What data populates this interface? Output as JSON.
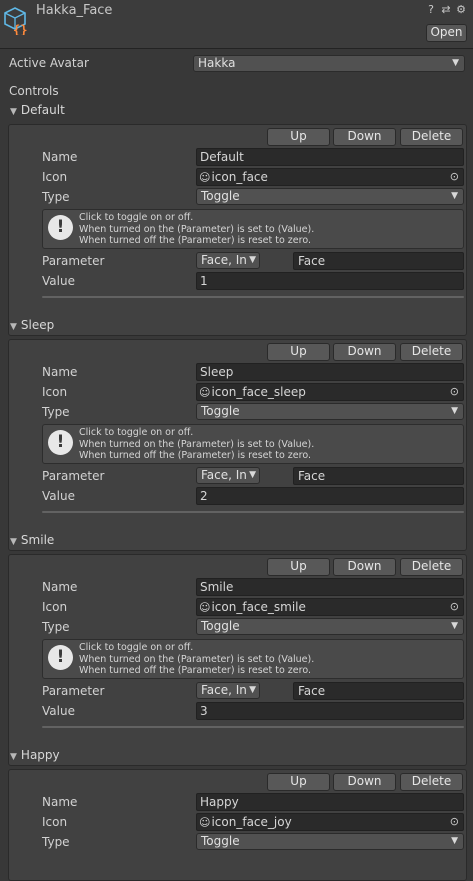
{
  "header": {
    "title": "Hakka_Face",
    "open_label": "Open",
    "help_icon": "?",
    "settings_icon": "⇄",
    "gear_icon": "⚙"
  },
  "active_avatar": {
    "label": "Active Avatar",
    "value": "Hakka"
  },
  "controls_label": "Controls",
  "controls": [
    {
      "title": "Default",
      "buttons": {
        "up": "Up",
        "down": "Down",
        "delete": "Delete"
      },
      "name_label": "Name",
      "name": "Default",
      "icon_label": "Icon",
      "icon": "icon_face",
      "type_label": "Type",
      "type": "Toggle",
      "help": [
        "Click to toggle on or off.",
        "When turned on the (Parameter) is set to (Value).",
        "When turned off the (Parameter) is reset to zero."
      ],
      "parameter_label": "Parameter",
      "parameter_type": "Face, In",
      "parameter": "Face",
      "value_label": "Value",
      "value": "1"
    },
    {
      "title": "Sleep",
      "buttons": {
        "up": "Up",
        "down": "Down",
        "delete": "Delete"
      },
      "name_label": "Name",
      "name": "Sleep",
      "icon_label": "Icon",
      "icon": "icon_face_sleep",
      "type_label": "Type",
      "type": "Toggle",
      "help": [
        "Click to toggle on or off.",
        "When turned on the (Parameter) is set to (Value).",
        "When turned off the (Parameter) is reset to zero."
      ],
      "parameter_label": "Parameter",
      "parameter_type": "Face, In",
      "parameter": "Face",
      "value_label": "Value",
      "value": "2"
    },
    {
      "title": "Smile",
      "buttons": {
        "up": "Up",
        "down": "Down",
        "delete": "Delete"
      },
      "name_label": "Name",
      "name": "Smile",
      "icon_label": "Icon",
      "icon": "icon_face_smile",
      "type_label": "Type",
      "type": "Toggle",
      "help": [
        "Click to toggle on or off.",
        "When turned on the (Parameter) is set to (Value).",
        "When turned off the (Parameter) is reset to zero."
      ],
      "parameter_label": "Parameter",
      "parameter_type": "Face, In",
      "parameter": "Face",
      "value_label": "Value",
      "value": "3"
    },
    {
      "title": "Happy",
      "buttons": {
        "up": "Up",
        "down": "Down",
        "delete": "Delete"
      },
      "name_label": "Name",
      "name": "Happy",
      "icon_label": "Icon",
      "icon": "icon_face_joy",
      "type_label": "Type",
      "type": "Toggle"
    }
  ]
}
